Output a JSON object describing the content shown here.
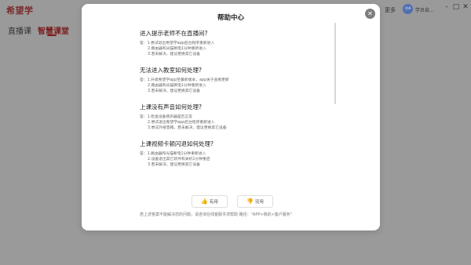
{
  "app": {
    "logo": "希望学",
    "nav": [
      "直播课",
      "智慧课堂"
    ],
    "more": "更多",
    "avatar_text": "小A",
    "user_name": "学员自...",
    "window_controls": [
      "-",
      "□",
      "✕"
    ]
  },
  "modal": {
    "title": "帮助中心",
    "close_icon": "✕",
    "faq": [
      {
        "question": "进入提示老师不在直播间?",
        "answers": [
          "答：1.尝试退出希望学app后台程序重新进入",
          "2.路由器和光猫断电1分钟重新进入",
          "3.若未解决，建议更换其它设备"
        ]
      },
      {
        "question": "无法进入教室如何处理?",
        "answers": [
          "答：1.升级希望学app至最新版本，app关于查看更新",
          "2.路由器和光猫断电1分钟重新进入",
          "3.若未解决，建议更换其它设备"
        ]
      },
      {
        "question": "上课没有声音如何处理?",
        "answers": [
          "答：1.检查设备扬声器是否正常",
          "2.尝试退出希望学app后台程序重新进入",
          "3.尝试外接音箱，若未解决，建议更换其它设备"
        ]
      },
      {
        "question": "上课视频卡顿闪退如何处理?",
        "answers": [
          "答：1.路由器和光猫断电1分钟重新进入",
          "2.设备退出其它软件和关机1分钟重启",
          "3.若未解决，建议更换其它设备"
        ]
      }
    ],
    "helpful_label": "有用",
    "unhelpful_label": "没用",
    "footer_note": "若上述答案不能解决您的问题，请咨询在线客服寻求帮助 路径：\"APP>我的>客户服务\""
  }
}
